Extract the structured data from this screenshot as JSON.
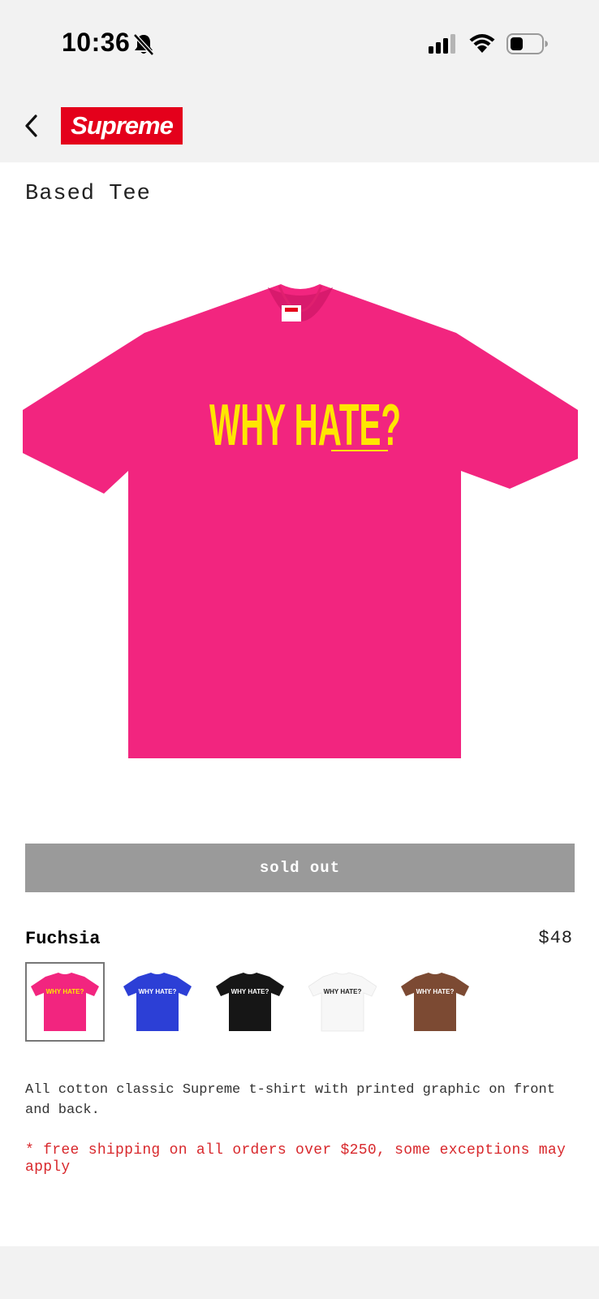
{
  "status_bar": {
    "time": "10:36",
    "icons": [
      "bell-slash-icon",
      "cellular-signal-icon",
      "wifi-icon",
      "battery-icon"
    ]
  },
  "nav": {
    "back_icon": "chevron-left-icon",
    "logo_text": "Supreme",
    "logo_color": "#e4001b"
  },
  "product": {
    "title": "Based Tee",
    "image": {
      "shirt_color": "#f2257f",
      "graphic_text": "WHY HATE?",
      "graphic_color": "#ffe600"
    },
    "button_label": "sold out",
    "button_color": "#9a9a9a",
    "selected_color_name": "Fuchsia",
    "price": "$48",
    "swatches": [
      {
        "color": "#f2257f",
        "text_color": "#ffe600",
        "selected": true
      },
      {
        "color": "#2c3fd6",
        "text_color": "#ffffff",
        "selected": false
      },
      {
        "color": "#161616",
        "text_color": "#ffffff",
        "selected": false
      },
      {
        "color": "#f7f7f7",
        "text_color": "#222222",
        "selected": false
      },
      {
        "color": "#7c4a33",
        "text_color": "#ffffff",
        "selected": false
      }
    ],
    "swatch_graphic_text": "WHY HATE?",
    "description": "All cotton classic Supreme t-shirt with printed graphic on front and back.",
    "shipping_note": "* free shipping on all orders over $250, some exceptions may apply"
  }
}
